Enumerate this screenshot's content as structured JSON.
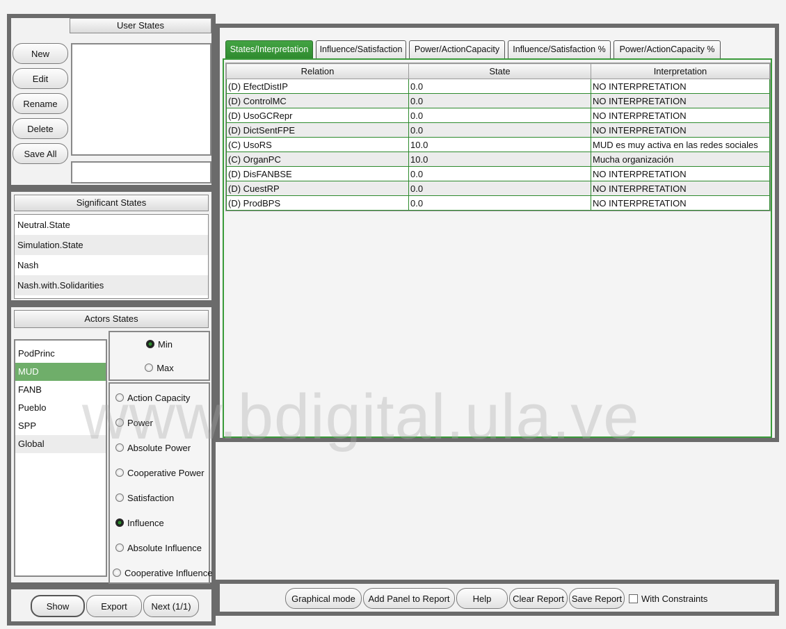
{
  "user_states": {
    "title": "User States",
    "buttons": [
      "New",
      "Edit",
      "Rename",
      "Delete",
      "Save All"
    ],
    "input_value": ""
  },
  "significant_states": {
    "title": "Significant States",
    "items": [
      "Neutral.State",
      "Simulation.State",
      "Nash",
      "Nash.with.Solidarities"
    ]
  },
  "actors_states": {
    "title": "Actors States",
    "actors": [
      "PodPrinc",
      "MUD",
      "FANB",
      "Pueblo",
      "SPP",
      "Global"
    ],
    "selected_actor": "MUD",
    "minmax": [
      "Min",
      "Max"
    ],
    "selected_minmax": "Min",
    "metrics": [
      "Action Capacity",
      "Power",
      "Absolute Power",
      "Cooperative Power",
      "Satisfaction",
      "Influence",
      "Absolute Influence",
      "Cooperative Influence"
    ],
    "selected_metric": "Influence"
  },
  "bottom_left_buttons": {
    "show": "Show",
    "export": "Export",
    "next": "Next (1/1)"
  },
  "tabs": [
    "States/Interpretation",
    "Influence/Satisfaction",
    "Power/ActionCapacity",
    "Influence/Satisfaction %",
    "Power/ActionCapacity %"
  ],
  "active_tab": "States/Interpretation",
  "table": {
    "headers": [
      "Relation",
      "State",
      "Interpretation"
    ],
    "rows": [
      [
        "(D) EfectDistIP",
        "0.0",
        "NO INTERPRETATION"
      ],
      [
        "(D) ControlMC",
        "0.0",
        "NO INTERPRETATION"
      ],
      [
        "(D) UsoGCRepr",
        "0.0",
        "NO INTERPRETATION"
      ],
      [
        "(D) DictSentFPE",
        "0.0",
        "NO INTERPRETATION"
      ],
      [
        "(C) UsoRS",
        "10.0",
        "MUD es muy activa en las redes sociales"
      ],
      [
        "(C) OrganPC",
        "10.0",
        "Mucha organización"
      ],
      [
        "(D) DisFANBSE",
        "0.0",
        "NO INTERPRETATION"
      ],
      [
        "(D) CuestRP",
        "0.0",
        "NO INTERPRETATION"
      ],
      [
        "(D) ProdBPS",
        "0.0",
        "NO INTERPRETATION"
      ]
    ]
  },
  "toolbar": {
    "graphical_mode": "Graphical mode",
    "add_panel": "Add Panel to Report",
    "help": "Help",
    "clear_report": "Clear Report",
    "save_report": "Save Report",
    "with_constraints": "With Constraints"
  },
  "watermark": "www.bdigital.ula.ve",
  "colors": {
    "accent_green": "#3a9a3a",
    "frame_gray": "#6b6b6b",
    "selected_row": "#6fae6a"
  }
}
